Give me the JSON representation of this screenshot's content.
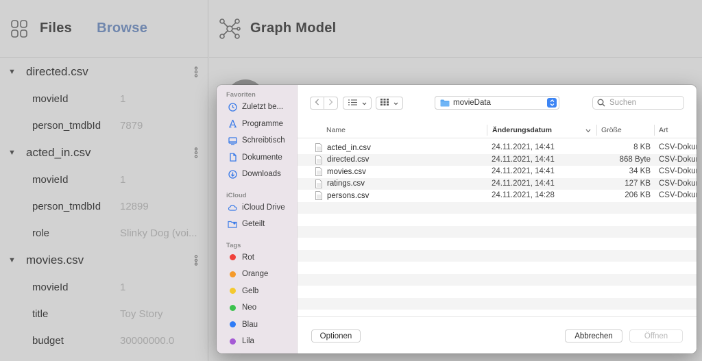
{
  "app": {
    "tabs": {
      "files": "Files",
      "browse": "Browse"
    },
    "graph_title": "Graph Model",
    "files": [
      {
        "name": "directed.csv",
        "fields": [
          {
            "name": "movieId",
            "value": "1"
          },
          {
            "name": "person_tmdbId",
            "value": "7879"
          }
        ]
      },
      {
        "name": "acted_in.csv",
        "fields": [
          {
            "name": "movieId",
            "value": "1"
          },
          {
            "name": "person_tmdbId",
            "value": "12899"
          },
          {
            "name": "role",
            "value": "Slinky Dog (voi..."
          }
        ]
      },
      {
        "name": "movies.csv",
        "fields": [
          {
            "name": "movieId",
            "value": "1"
          },
          {
            "name": "title",
            "value": "Toy Story"
          },
          {
            "name": "budget",
            "value": "30000000.0"
          }
        ]
      }
    ]
  },
  "dialog": {
    "sidebar": {
      "favorites_title": "Favoriten",
      "favorites": [
        {
          "label": "Zuletzt be...",
          "icon": "clock-icon"
        },
        {
          "label": "Programme",
          "icon": "apps-icon"
        },
        {
          "label": "Schreibtisch",
          "icon": "desktop-icon"
        },
        {
          "label": "Dokumente",
          "icon": "document-icon"
        },
        {
          "label": "Downloads",
          "icon": "download-icon"
        }
      ],
      "icloud_title": "iCloud",
      "icloud": [
        {
          "label": "iCloud Drive",
          "icon": "cloud-icon"
        },
        {
          "label": "Geteilt",
          "icon": "shared-folder-icon"
        }
      ],
      "tags_title": "Tags",
      "tags": [
        {
          "label": "Rot",
          "color": "#f0413b"
        },
        {
          "label": "Orange",
          "color": "#f59a2a"
        },
        {
          "label": "Gelb",
          "color": "#f4c92f"
        },
        {
          "label": "Neo",
          "color": "#3cc24e"
        },
        {
          "label": "Blau",
          "color": "#2f7cf6"
        },
        {
          "label": "Lila",
          "color": "#a55ad5"
        }
      ]
    },
    "folder": "movieData",
    "search_placeholder": "Suchen",
    "columns": {
      "name": "Name",
      "date": "Änderungsdatum",
      "size": "Größe",
      "kind": "Art"
    },
    "files": [
      {
        "name": "acted_in.csv",
        "date": "24.11.2021, 14:41",
        "size": "8 KB",
        "kind": "CSV-Dokument"
      },
      {
        "name": "directed.csv",
        "date": "24.11.2021, 14:41",
        "size": "868 Byte",
        "kind": "CSV-Dokument"
      },
      {
        "name": "movies.csv",
        "date": "24.11.2021, 14:41",
        "size": "34 KB",
        "kind": "CSV-Dokument"
      },
      {
        "name": "ratings.csv",
        "date": "24.11.2021, 14:41",
        "size": "127 KB",
        "kind": "CSV-Dokument"
      },
      {
        "name": "persons.csv",
        "date": "24.11.2021, 14:28",
        "size": "206 KB",
        "kind": "CSV-Dokument"
      }
    ],
    "buttons": {
      "options": "Optionen",
      "cancel": "Abbrechen",
      "open": "Öffnen"
    }
  }
}
